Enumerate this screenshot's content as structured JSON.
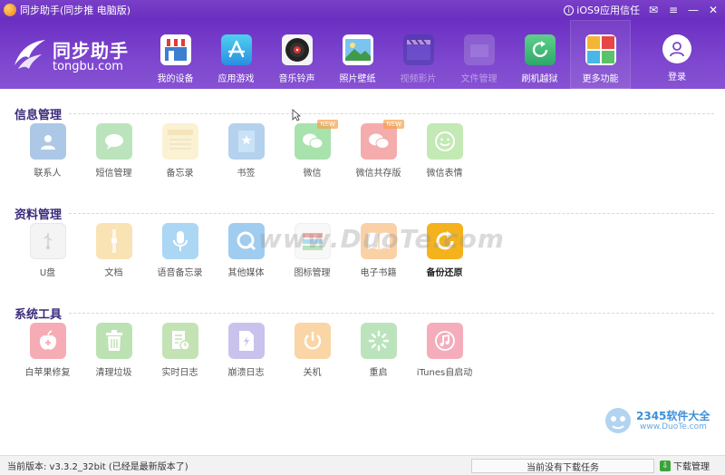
{
  "window": {
    "title": "同步助手(同步推 电脑版)",
    "ios_trust_label": "iOS9应用信任",
    "controls": {
      "feedback": "✉",
      "menu": "≡",
      "minimize": "—",
      "close": "✕"
    }
  },
  "logo": {
    "cn": "同步助手",
    "en": "tongbu.com"
  },
  "nav": {
    "items": [
      {
        "label": "我的设备",
        "icon": "store-icon"
      },
      {
        "label": "应用游戏",
        "icon": "app-store-icon"
      },
      {
        "label": "音乐铃声",
        "icon": "vinyl-icon"
      },
      {
        "label": "照片壁纸",
        "icon": "picture-icon"
      },
      {
        "label": "视频影片",
        "icon": "film-icon"
      },
      {
        "label": "文件管理",
        "icon": "folder-icon"
      },
      {
        "label": "刷机越狱",
        "icon": "refresh-icon"
      },
      {
        "label": "更多功能",
        "icon": "grid-icon"
      }
    ],
    "login_label": "登录"
  },
  "sections": {
    "info": {
      "title": "信息管理",
      "items": [
        {
          "label": "联系人"
        },
        {
          "label": "短信管理"
        },
        {
          "label": "备忘录"
        },
        {
          "label": "书签"
        },
        {
          "label": "微信",
          "badge": "NEW"
        },
        {
          "label": "微信共存版",
          "badge": "NEW"
        },
        {
          "label": "微信表情"
        }
      ]
    },
    "data": {
      "title": "资料管理",
      "items": [
        {
          "label": "U盘"
        },
        {
          "label": "文档"
        },
        {
          "label": "语音备忘录"
        },
        {
          "label": "其他媒体"
        },
        {
          "label": "图标管理"
        },
        {
          "label": "电子书籍"
        },
        {
          "label": "备份还原"
        }
      ]
    },
    "tools": {
      "title": "系统工具",
      "items": [
        {
          "label": "白苹果修复"
        },
        {
          "label": "清理垃圾"
        },
        {
          "label": "实时日志"
        },
        {
          "label": "崩溃日志"
        },
        {
          "label": "关机"
        },
        {
          "label": "重启"
        },
        {
          "label": "iTunes自启动"
        }
      ]
    }
  },
  "watermarks": {
    "duote": "www.DuoTe.com",
    "brand": "2345软件大全",
    "brand_url": "www.DuoTe.com"
  },
  "status": {
    "version": "当前版本: v3.3.2_32bit  (已经是最新版本了)",
    "tasks": "当前没有下载任务",
    "download_manager": "下载管理"
  },
  "colors": {
    "header": "#6b2fc2",
    "section_title": "#3a2a7a",
    "accent_badge": "#f5a24b"
  }
}
